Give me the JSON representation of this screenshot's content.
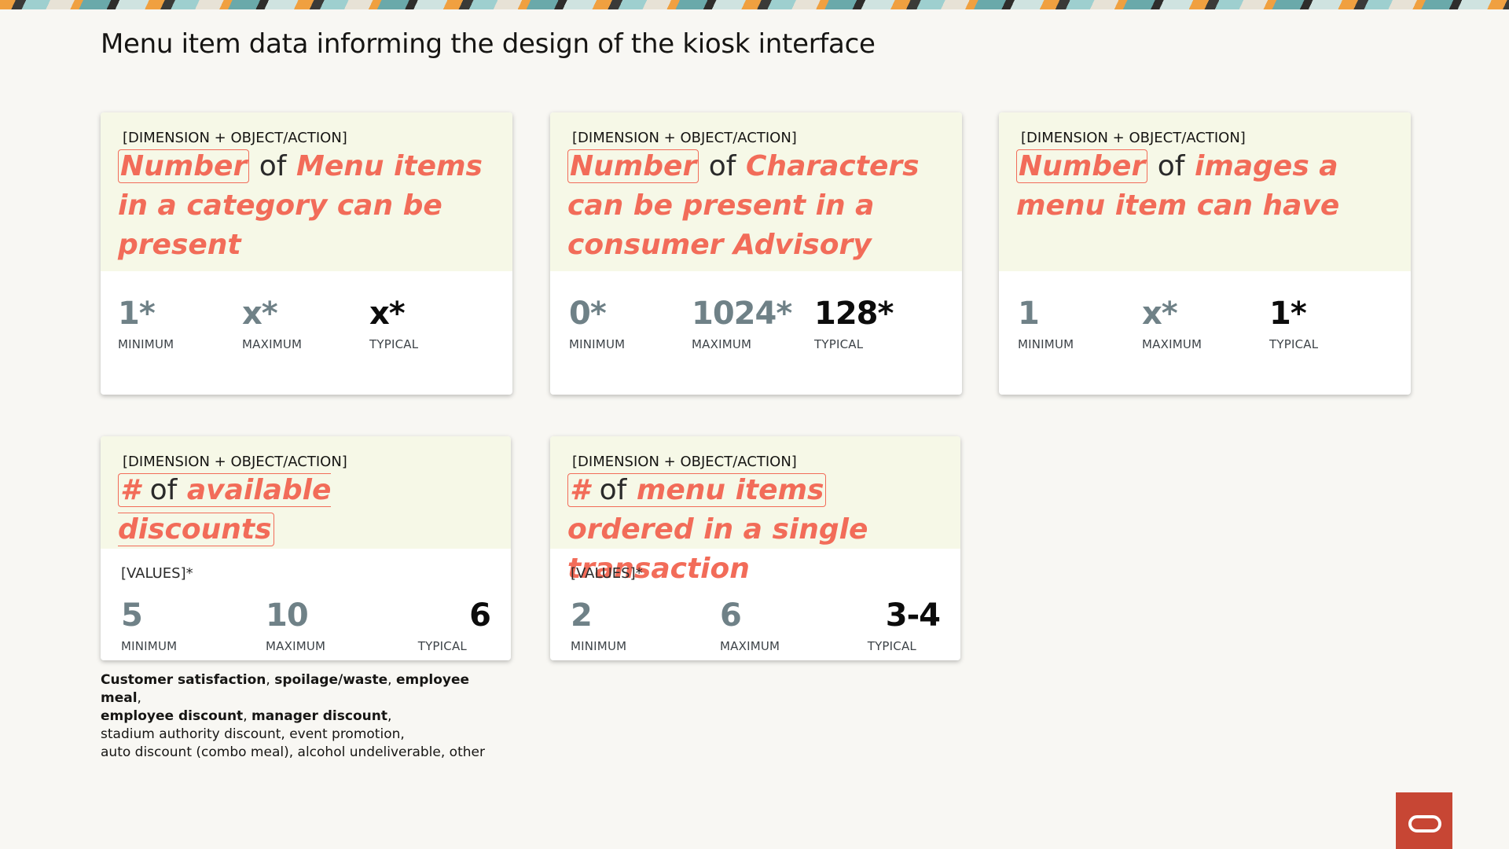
{
  "title": "Menu item data informing the design of the kiosk interface",
  "colors": {
    "accent": "#f26c59",
    "card_header_bg": "#f6f8e7",
    "muted_number": "#6f8187",
    "logo": "#c74634"
  },
  "cards": [
    {
      "dimension_label": "[DIMENSION + OBJECT/ACTION]",
      "headline": {
        "measure": "Number",
        "of": "of",
        "rest": "Menu items in a category can be present"
      },
      "stats": [
        {
          "value": "1*",
          "label": "MINIMUM"
        },
        {
          "value": "x*",
          "label": "MAXIMUM"
        },
        {
          "value": "x*",
          "label": "TYPICAL"
        }
      ]
    },
    {
      "dimension_label": "[DIMENSION + OBJECT/ACTION]",
      "headline": {
        "measure": "Number",
        "of": "of",
        "rest": "Characters can be present in a consumer Advisory"
      },
      "stats": [
        {
          "value": "0*",
          "label": "MINIMUM"
        },
        {
          "value": "1024*",
          "label": "MAXIMUM"
        },
        {
          "value": "128*",
          "label": "TYPICAL"
        }
      ]
    },
    {
      "dimension_label": "[DIMENSION + OBJECT/ACTION]",
      "headline": {
        "measure": "Number",
        "of": "of",
        "rest": "images a menu item can have"
      },
      "stats": [
        {
          "value": "1",
          "label": "MINIMUM"
        },
        {
          "value": "x*",
          "label": "MAXIMUM"
        },
        {
          "value": "1*",
          "label": "TYPICAL"
        }
      ]
    },
    {
      "dimension_label": "[DIMENSION + OBJECT/ACTION]",
      "headline": {
        "measure": "#",
        "of": "of",
        "object": "available discounts"
      },
      "values_label": "[VALUES]*",
      "stats": [
        {
          "value": "5",
          "label": "MINIMUM"
        },
        {
          "value": "10",
          "label": "MAXIMUM"
        },
        {
          "value": "6",
          "label": "TYPICAL"
        }
      ]
    },
    {
      "dimension_label": "[DIMENSION + OBJECT/ACTION]",
      "headline": {
        "measure": "#",
        "of": "of",
        "object": "menu items",
        "rest": "ordered in a single transaction"
      },
      "values_label": "[VALUES]*",
      "stats": [
        {
          "value": "2",
          "label": "MINIMUM"
        },
        {
          "value": "6",
          "label": "MAXIMUM"
        },
        {
          "value": "3-4",
          "label": "TYPICAL"
        }
      ]
    }
  ],
  "footnote": {
    "bold_items": [
      "Customer satisfaction",
      "spoilage/waste",
      "employee meal",
      "employee discount",
      "manager discount"
    ],
    "line3": "stadium authority discount, event promotion,",
    "line4": "auto discount (combo meal), alcohol undeliverable, other"
  }
}
